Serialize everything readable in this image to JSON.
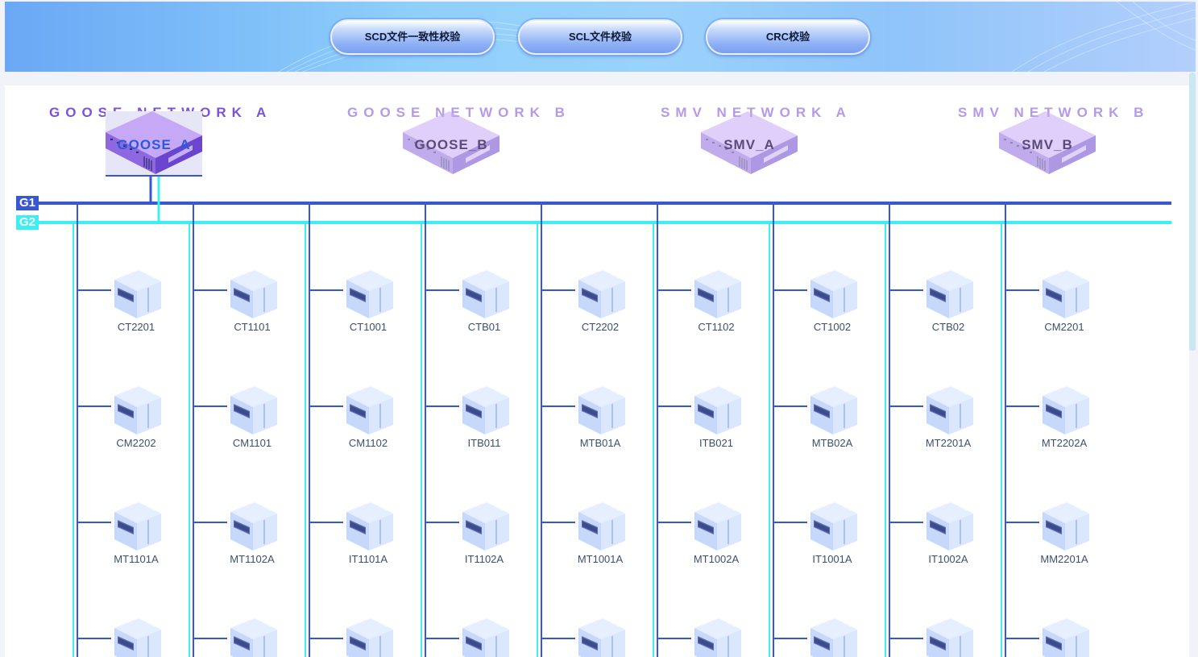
{
  "toolbar": {
    "buttons": [
      {
        "label": "SCD文件一致性校验"
      },
      {
        "label": "SCL文件校验"
      },
      {
        "label": "CRC校验"
      }
    ]
  },
  "networks": [
    {
      "title": "GOOSE NETWORK A",
      "switch": "GOOSE_A",
      "selected": true
    },
    {
      "title": "GOOSE NETWORK B",
      "switch": "GOOSE_B",
      "selected": false
    },
    {
      "title": "SMV NETWORK A",
      "switch": "SMV_A",
      "selected": false
    },
    {
      "title": "SMV NETWORK B",
      "switch": "SMV_B",
      "selected": false
    }
  ],
  "buses": {
    "g1": "G1",
    "g2": "G2"
  },
  "colors": {
    "g1": "#3a57d3",
    "g2": "#3deef2",
    "title_active": "#7b52dc",
    "title_inactive": "#b49ae8"
  },
  "devices": [
    [
      "CT2201",
      "CM2202",
      "MT1101A",
      ""
    ],
    [
      "CT1101",
      "CM1101",
      "MT1102A",
      ""
    ],
    [
      "CT1001",
      "CM1102",
      "IT1101A",
      ""
    ],
    [
      "CTB01",
      "ITB011",
      "IT1102A",
      ""
    ],
    [
      "CT2202",
      "MTB01A",
      "MT1001A",
      ""
    ],
    [
      "CT1102",
      "ITB021",
      "MT1002A",
      ""
    ],
    [
      "CT1002",
      "MTB02A",
      "IT1001A",
      ""
    ],
    [
      "CTB02",
      "MT2201A",
      "IT1002A",
      ""
    ],
    [
      "CM2201",
      "MT2202A",
      "MM2201A",
      ""
    ]
  ]
}
